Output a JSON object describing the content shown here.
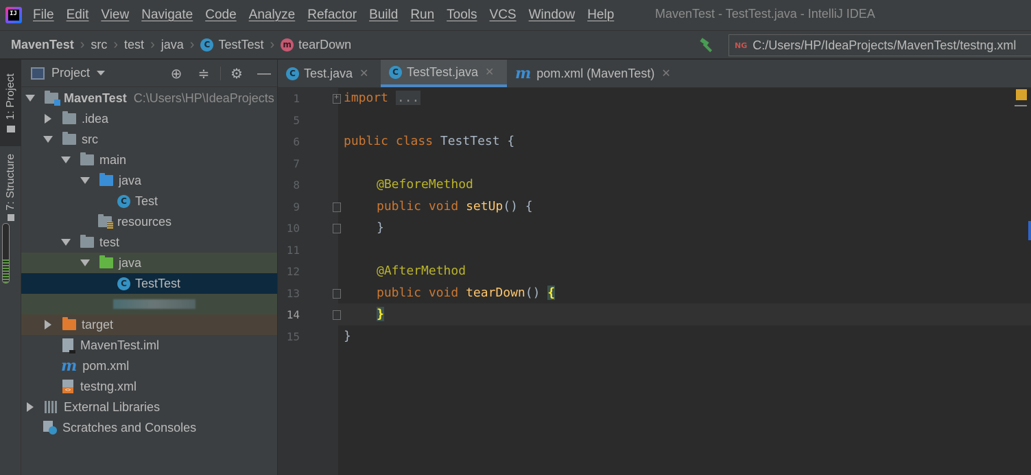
{
  "menu": [
    "File",
    "Edit",
    "View",
    "Navigate",
    "Code",
    "Analyze",
    "Refactor",
    "Build",
    "Run",
    "Tools",
    "VCS",
    "Window",
    "Help"
  ],
  "window_title": "MavenTest - TestTest.java - IntelliJ IDEA",
  "breadcrumb": {
    "project": "MavenTest",
    "parts": [
      "src",
      "test",
      "java"
    ],
    "class": "TestTest",
    "method": "tearDown"
  },
  "run_config": "C:/Users/HP/IdeaProjects/MavenTest/testng.xml",
  "toolstrip": {
    "project_tab": "1: Project",
    "structure_tab": "7: Structure"
  },
  "project_panel": {
    "title": "Project",
    "tree": {
      "root": "MavenTest",
      "root_path": "C:\\Users\\HP\\IdeaProjects",
      "idea": ".idea",
      "src": "src",
      "main": "main",
      "main_java": "java",
      "test_class": "Test",
      "resources": "resources",
      "test": "test",
      "test_java": "java",
      "testtest": "TestTest",
      "target": "target",
      "iml": "MavenTest.iml",
      "pom": "pom.xml",
      "testng": "testng.xml",
      "ext_libs": "External Libraries",
      "scratches": "Scratches and Consoles"
    }
  },
  "editor_tabs": [
    {
      "label": "Test.java",
      "active": false
    },
    {
      "label": "TestTest.java",
      "active": true
    },
    {
      "label": "pom.xml (MavenTest)",
      "active": false
    }
  ],
  "line_numbers": [
    "1",
    "5",
    "6",
    "7",
    "8",
    "9",
    "10",
    "11",
    "12",
    "13",
    "14",
    "15"
  ],
  "code": {
    "l1_kw": "import",
    "l1_fold": "...",
    "l6_kw": "public class",
    "l6_name": " TestTest {",
    "l8_ann": "@BeforeMethod",
    "l9_kw": "public void",
    "l9_fn": "setUp",
    "l9_rest": "() {",
    "l10": "}",
    "l12_ann": "@AfterMethod",
    "l13_kw": "public void",
    "l13_fn": "tearDown",
    "l13_rest": "() ",
    "l13_brace": "{",
    "l14_brace": "}",
    "l15": "}"
  },
  "colors": {
    "accent": "#4a88c7",
    "keyword": "#cc7832",
    "annotation": "#bbb529",
    "method": "#ffc66d"
  }
}
